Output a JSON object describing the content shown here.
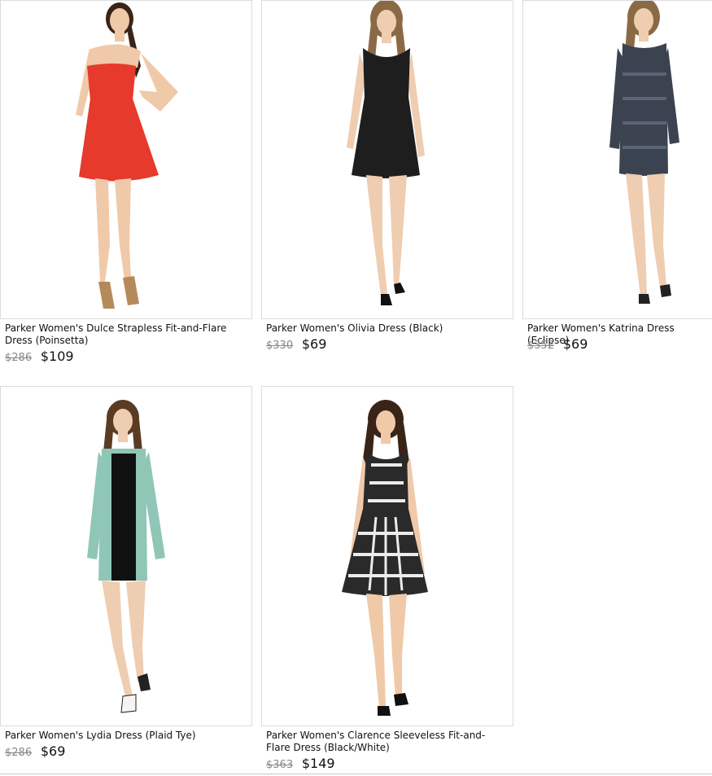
{
  "products": [
    {
      "title": "Parker Women's Dulce Strapless Fit-and-Flare Dress (Poinsetta)",
      "list_price": "$286",
      "sale_price": "$109",
      "image": "red-strapless-dress-photo",
      "dress_color": "#e53a2c",
      "hair_color": "#3a2418"
    },
    {
      "title": "Parker Women's Olivia Dress (Black)",
      "list_price": "$330",
      "sale_price": "$69",
      "image": "black-sleeveless-dress-photo",
      "dress_color": "#1e1e1e",
      "hair_color": "#8a6a45"
    },
    {
      "title": "Parker Women's Katrina Dress (Eclipse)",
      "list_price": "$352",
      "sale_price": "$69",
      "image": "grey-longsleeve-dress-photo",
      "dress_color": "#3b4250",
      "hair_color": "#8a6a45"
    },
    {
      "title": "Parker Women's Lydia Dress (Plaid Tye)",
      "list_price": "$286",
      "sale_price": "$69",
      "image": "plaid-longsleeve-dress-photo",
      "dress_color": "#8fc6b6",
      "hair_color": "#5a3b24"
    },
    {
      "title": "Parker Women's Clarence Sleeveless Fit-and-Flare Dress (Black/White)",
      "list_price": "$363",
      "sale_price": "$149",
      "image": "black-white-print-dress-photo",
      "dress_color": "#2a2a2a",
      "hair_color": "#3a2418"
    }
  ]
}
